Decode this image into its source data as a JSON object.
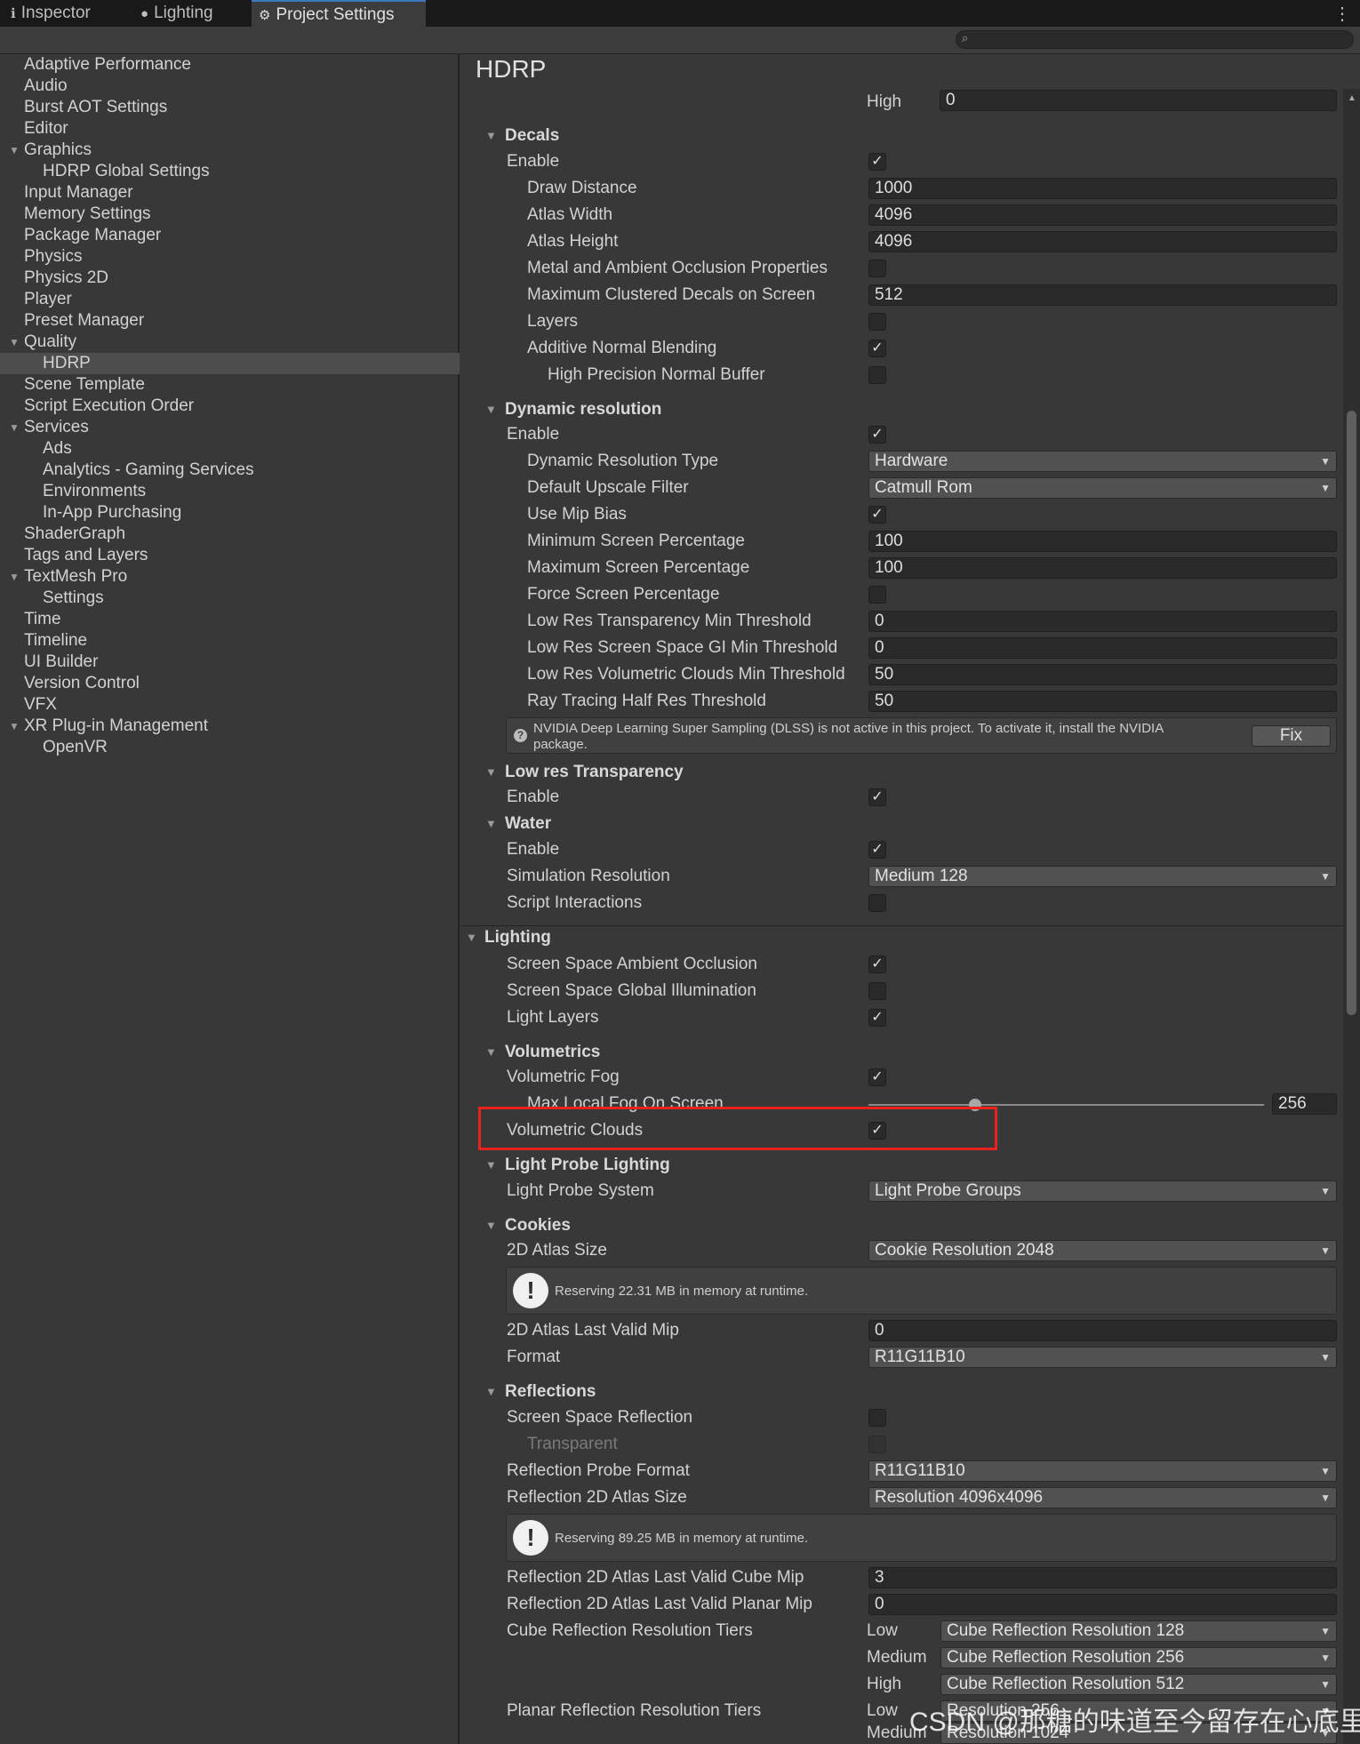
{
  "tabs": [
    {
      "label": "Inspector",
      "icon": "info-icon"
    },
    {
      "label": "Lighting",
      "icon": "bulb-icon"
    },
    {
      "label": "Project Settings",
      "icon": "gear-icon",
      "active": true
    }
  ],
  "sidebar": {
    "items": [
      {
        "label": "Adaptive Performance"
      },
      {
        "label": "Audio"
      },
      {
        "label": "Burst AOT Settings"
      },
      {
        "label": "Editor"
      },
      {
        "label": "Graphics",
        "expanded": true
      },
      {
        "label": "HDRP Global Settings",
        "child": true
      },
      {
        "label": "Input Manager"
      },
      {
        "label": "Memory Settings"
      },
      {
        "label": "Package Manager"
      },
      {
        "label": "Physics"
      },
      {
        "label": "Physics 2D"
      },
      {
        "label": "Player"
      },
      {
        "label": "Preset Manager"
      },
      {
        "label": "Quality",
        "expanded": true
      },
      {
        "label": "HDRP",
        "child": true,
        "selected": true
      },
      {
        "label": "Scene Template"
      },
      {
        "label": "Script Execution Order"
      },
      {
        "label": "Services",
        "expanded": true
      },
      {
        "label": "Ads",
        "child": true
      },
      {
        "label": "Analytics - Gaming Services",
        "child": true
      },
      {
        "label": "Environments",
        "child": true
      },
      {
        "label": "In-App Purchasing",
        "child": true
      },
      {
        "label": "ShaderGraph"
      },
      {
        "label": "Tags and Layers"
      },
      {
        "label": "TextMesh Pro",
        "expanded": true
      },
      {
        "label": "Settings",
        "child": true
      },
      {
        "label": "Time"
      },
      {
        "label": "Timeline"
      },
      {
        "label": "UI Builder"
      },
      {
        "label": "Version Control"
      },
      {
        "label": "VFX"
      },
      {
        "label": "XR Plug-in Management",
        "expanded": true
      },
      {
        "label": "OpenVR",
        "child": true
      }
    ]
  },
  "page": {
    "title": "HDRP"
  },
  "settings": {
    "top_high_label": "High",
    "top_high_value": "0",
    "decals": {
      "header": "Decals",
      "enable": "Enable",
      "draw_distance": "Draw Distance",
      "draw_distance_value": "1000",
      "atlas_width": "Atlas Width",
      "atlas_width_value": "4096",
      "atlas_height": "Atlas Height",
      "atlas_height_value": "4096",
      "metal_ao": "Metal and Ambient Occlusion Properties",
      "max_clustered": "Maximum Clustered Decals on Screen",
      "max_clustered_value": "512",
      "layers": "Layers",
      "additive": "Additive Normal Blending",
      "high_precision": "High Precision Normal Buffer"
    },
    "dynres": {
      "header": "Dynamic resolution",
      "enable": "Enable",
      "type": "Dynamic Resolution Type",
      "type_value": "Hardware",
      "upscale": "Default Upscale Filter",
      "upscale_value": "Catmull Rom",
      "mip_bias": "Use Mip Bias",
      "min_pct": "Minimum Screen Percentage",
      "min_pct_value": "100",
      "max_pct": "Maximum Screen Percentage",
      "max_pct_value": "100",
      "force_pct": "Force Screen Percentage",
      "lr_transp": "Low Res Transparency Min Threshold",
      "lr_transp_value": "0",
      "lr_ssgi": "Low Res Screen Space GI Min Threshold",
      "lr_ssgi_value": "0",
      "lr_clouds": "Low Res Volumetric Clouds Min Threshold",
      "lr_clouds_value": "50",
      "rt_half": "Ray Tracing Half Res Threshold",
      "rt_half_value": "50",
      "dlss_msg_1": "NVIDIA Deep Learning Super Sampling (DLSS) is not active in this project. To activate it, install the NVIDIA",
      "dlss_msg_2": "package.",
      "fix": "Fix"
    },
    "lowres": {
      "header": "Low res Transparency",
      "enable": "Enable"
    },
    "water": {
      "header": "Water",
      "enable": "Enable",
      "sim_res": "Simulation Resolution",
      "sim_res_value": "Medium 128",
      "script": "Script Interactions"
    },
    "lighting": {
      "header": "Lighting",
      "ssao": "Screen Space Ambient Occlusion",
      "ssgi": "Screen Space Global Illumination",
      "light_layers": "Light Layers"
    },
    "volumetrics": {
      "header": "Volumetrics",
      "fog": "Volumetric Fog",
      "max_fog": "Max Local Fog On Screen",
      "max_fog_value": "256",
      "max_fog_fraction": 0.27,
      "clouds": "Volumetric Clouds"
    },
    "probe": {
      "header": "Light Probe Lighting",
      "system": "Light Probe System",
      "system_value": "Light Probe Groups"
    },
    "cookies": {
      "header": "Cookies",
      "atlas_size": "2D Atlas Size",
      "atlas_size_value": "Cookie Resolution 2048",
      "reserve": "Reserving 22.31 MB in memory at runtime.",
      "last_mip": "2D Atlas Last Valid Mip",
      "last_mip_value": "0",
      "format": "Format",
      "format_value": "R11G11B10"
    },
    "reflections": {
      "header": "Reflections",
      "ssr": "Screen Space Reflection",
      "transparent": "Transparent",
      "probe_format": "Reflection Probe Format",
      "probe_format_value": "R11G11B10",
      "atlas2d": "Reflection 2D Atlas Size",
      "atlas2d_value": "Resolution 4096x4096",
      "reserve": "Reserving 89.25 MB in memory at runtime.",
      "cube_mip": "Reflection 2D Atlas Last Valid Cube Mip",
      "cube_mip_value": "3",
      "planar_mip": "Reflection 2D Atlas Last Valid Planar Mip",
      "planar_mip_value": "0",
      "cube_tiers": "Cube Reflection Resolution Tiers",
      "low": "Low",
      "medium": "Medium",
      "high": "High",
      "cube_low": "Cube Reflection Resolution 128",
      "cube_medium": "Cube Reflection Resolution 256",
      "cube_high": "Cube Reflection Resolution 512",
      "planar_tiers": "Planar Reflection Resolution Tiers",
      "planar_low": "Resolution 256",
      "planar_medium": "Resolution 1024"
    }
  },
  "watermark": "CSDN @那糖的味道至今留存在心底里",
  "colors": {
    "highlight": "#e8231f",
    "accent": "#3a79bb"
  }
}
